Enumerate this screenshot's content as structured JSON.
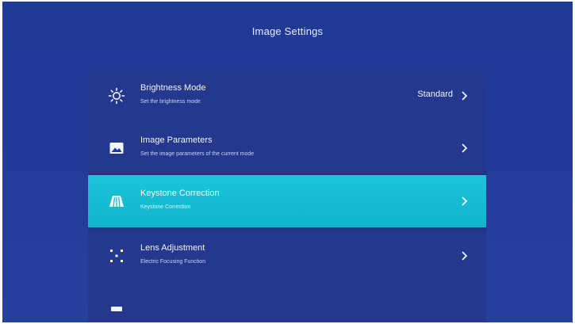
{
  "header": {
    "title": "Image Settings"
  },
  "menu": {
    "items": [
      {
        "icon": "brightness-icon",
        "title": "Brightness Mode",
        "subtitle": "Set the brightness mode",
        "value": "Standard",
        "selected": false
      },
      {
        "icon": "image-icon",
        "title": "Image Parameters",
        "subtitle": "Set the image parameters of the current mode",
        "value": "",
        "selected": false
      },
      {
        "icon": "keystone-icon",
        "title": "Keystone Correction",
        "subtitle": "Keystone Correction",
        "value": "",
        "selected": true
      },
      {
        "icon": "lens-icon",
        "title": "Lens Adjustment",
        "subtitle": "Electric Focusing Function",
        "value": "",
        "selected": false
      }
    ],
    "partial_item": {
      "icon": "display-icon"
    }
  },
  "colors": {
    "background": "#233a98",
    "panel": "#24388e",
    "selected": "#17bcd2",
    "text": "#f1f4ff"
  }
}
